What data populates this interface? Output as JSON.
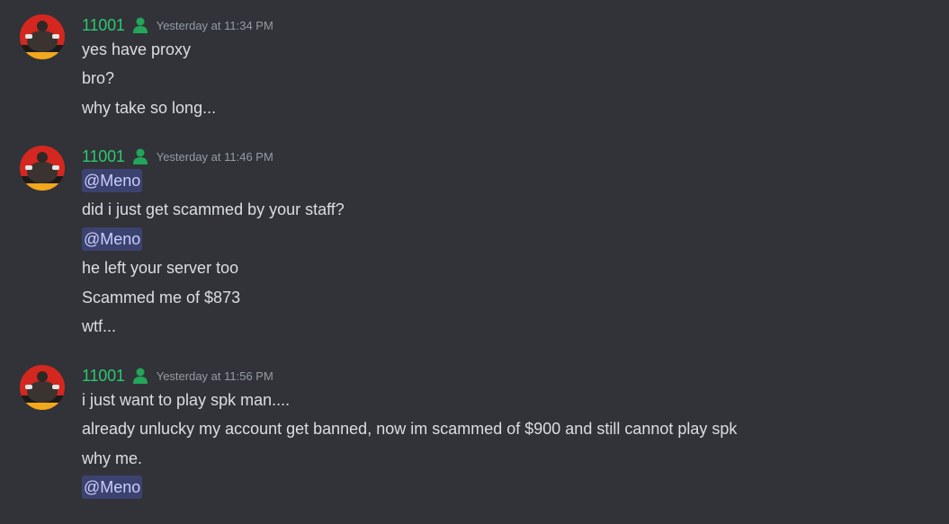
{
  "colors": {
    "background": "#313338",
    "username": "#2dc770",
    "role_icon": "#23a55a",
    "timestamp": "#949ba4",
    "message_text": "#dbdee1",
    "mention_bg": "#3c4270",
    "mention_text": "#c9cdfb"
  },
  "groups": [
    {
      "username": "11001",
      "role_icon": "person-icon",
      "timestamp": "Yesterday at 11:34 PM",
      "messages": [
        {
          "text": "yes have proxy"
        },
        {
          "text": "bro?"
        },
        {
          "text": "why take so long..."
        }
      ]
    },
    {
      "username": "11001",
      "role_icon": "person-icon",
      "timestamp": "Yesterday at 11:46 PM",
      "messages": [
        {
          "mention": "@Meno"
        },
        {
          "text": "did i just get scammed by your staff?"
        },
        {
          "mention": "@Meno"
        },
        {
          "text": "he left your server too"
        },
        {
          "text": "Scammed me of $873"
        },
        {
          "text": "wtf..."
        }
      ]
    },
    {
      "username": "11001",
      "role_icon": "person-icon",
      "timestamp": "Yesterday at 11:56 PM",
      "messages": [
        {
          "text": "i just want to play spk man...."
        },
        {
          "text": "already unlucky my account get banned, now im scammed of $900 and still cannot play spk"
        },
        {
          "text": "why me."
        },
        {
          "mention": "@Meno"
        }
      ]
    }
  ]
}
